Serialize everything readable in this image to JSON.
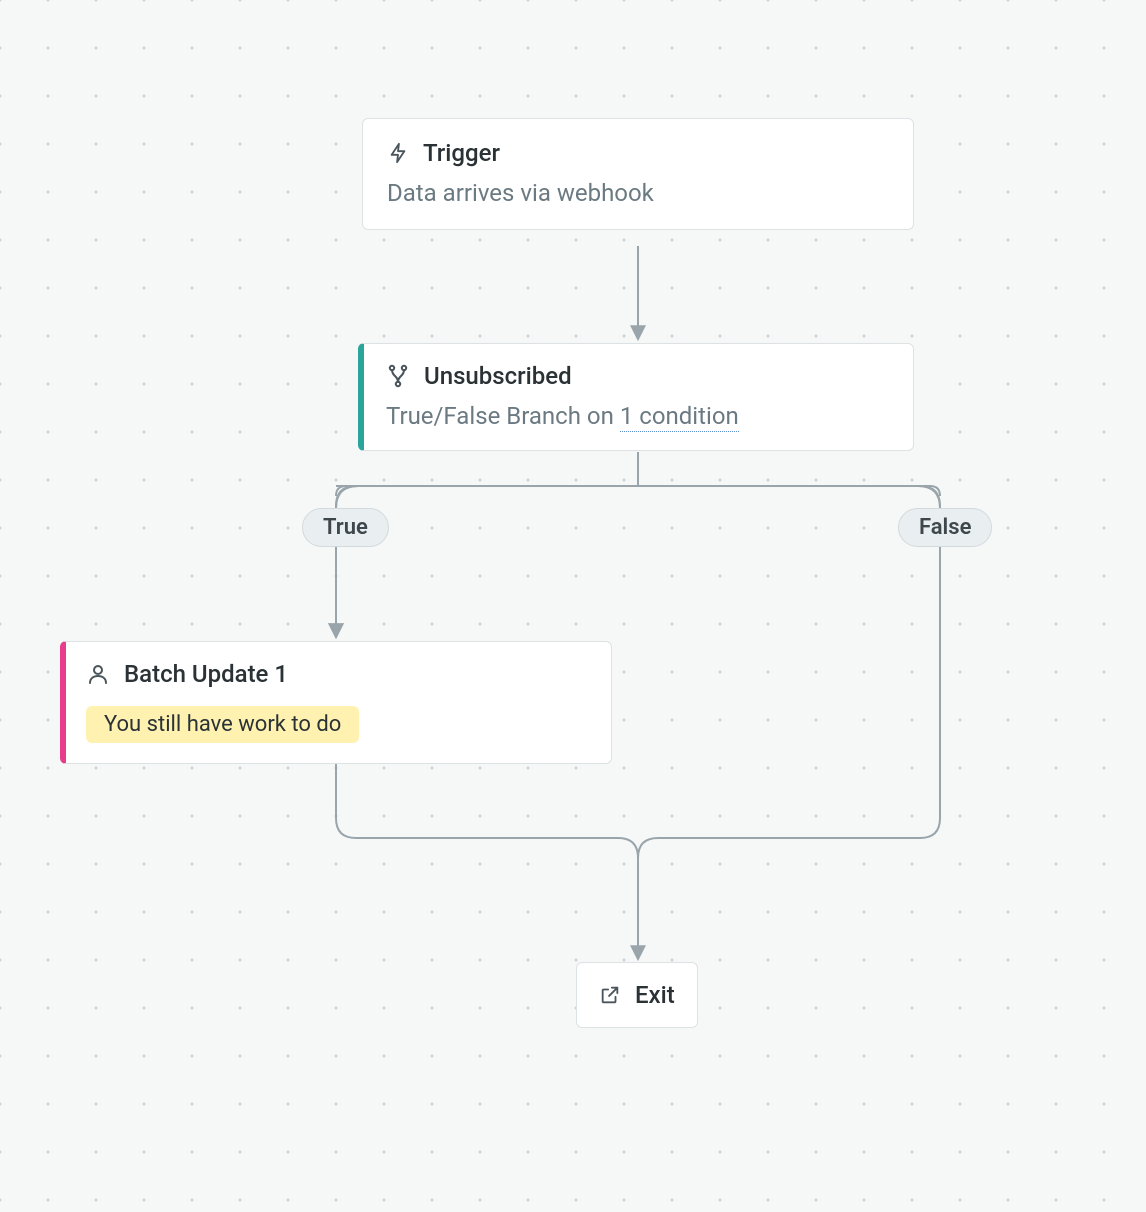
{
  "trigger": {
    "title": "Trigger",
    "subtitle": "Data arrives via webhook"
  },
  "branch": {
    "title": "Unsubscribed",
    "subtitle_prefix": "True/False Branch on ",
    "condition_text": "1 condition",
    "true_label": "True",
    "false_label": "False"
  },
  "action": {
    "title": "Batch Update 1",
    "warning": "You still have work to do"
  },
  "exit": {
    "label": "Exit"
  }
}
